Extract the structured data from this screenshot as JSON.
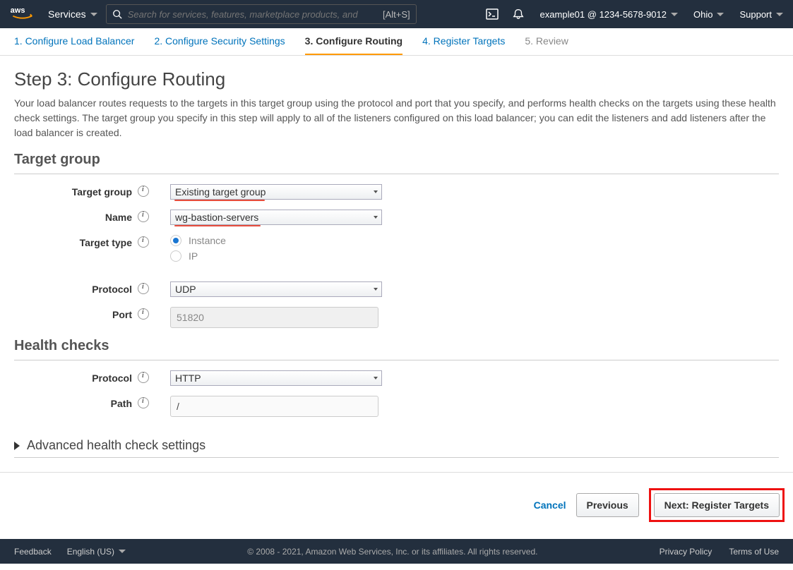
{
  "nav": {
    "services": "Services",
    "search_placeholder": "Search for services, features, marketplace products, and",
    "search_hotkey": "[Alt+S]",
    "account": "example01 @ 1234-5678-9012",
    "region": "Ohio",
    "support": "Support"
  },
  "tabs": [
    "1. Configure Load Balancer",
    "2. Configure Security Settings",
    "3. Configure Routing",
    "4. Register Targets",
    "5. Review"
  ],
  "step": {
    "title": "Step 3: Configure Routing",
    "desc": "Your load balancer routes requests to the targets in this target group using the protocol and port that you specify, and performs health checks on the targets using these health check settings. The target group you specify in this step will apply to all of the listeners configured on this load balancer; you can edit the listeners and add listeners after the load balancer is created."
  },
  "target_group": {
    "section": "Target group",
    "fields": {
      "target_group_label": "Target group",
      "target_group_value": "Existing target group",
      "name_label": "Name",
      "name_value": "wg-bastion-servers",
      "target_type_label": "Target type",
      "target_type_opt_instance": "Instance",
      "target_type_opt_ip": "IP",
      "protocol_label": "Protocol",
      "protocol_value": "UDP",
      "port_label": "Port",
      "port_value": "51820"
    }
  },
  "health": {
    "section": "Health checks",
    "fields": {
      "protocol_label": "Protocol",
      "protocol_value": "HTTP",
      "path_label": "Path",
      "path_value": "/"
    },
    "advanced": "Advanced health check settings"
  },
  "actions": {
    "cancel": "Cancel",
    "previous": "Previous",
    "next": "Next: Register Targets"
  },
  "footer": {
    "feedback": "Feedback",
    "language": "English (US)",
    "copyright": "© 2008 - 2021, Amazon Web Services, Inc. or its affiliates. All rights reserved.",
    "privacy": "Privacy Policy",
    "terms": "Terms of Use"
  }
}
